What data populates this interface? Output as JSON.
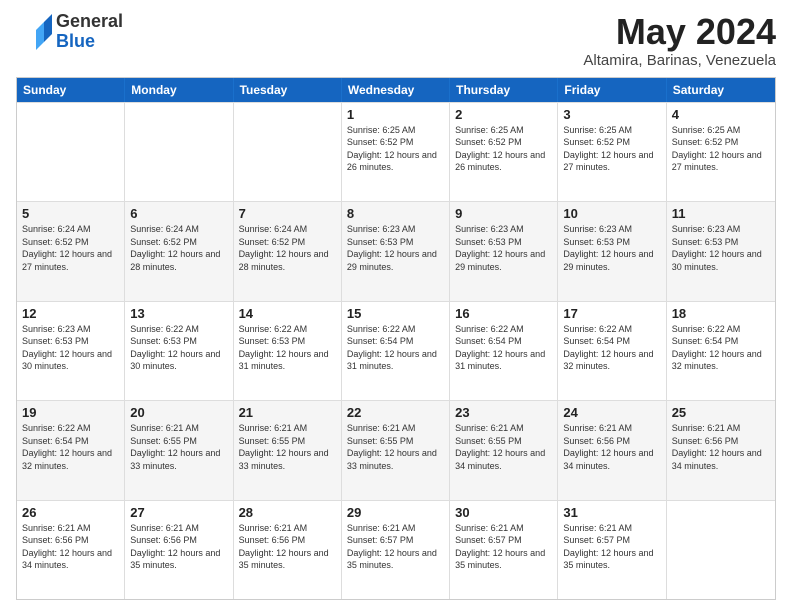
{
  "header": {
    "logo_general": "General",
    "logo_blue": "Blue",
    "month_title": "May 2024",
    "subtitle": "Altamira, Barinas, Venezuela"
  },
  "days_of_week": [
    "Sunday",
    "Monday",
    "Tuesday",
    "Wednesday",
    "Thursday",
    "Friday",
    "Saturday"
  ],
  "weeks": [
    [
      {
        "day": "",
        "info": ""
      },
      {
        "day": "",
        "info": ""
      },
      {
        "day": "",
        "info": ""
      },
      {
        "day": "1",
        "info": "Sunrise: 6:25 AM\nSunset: 6:52 PM\nDaylight: 12 hours\nand 26 minutes."
      },
      {
        "day": "2",
        "info": "Sunrise: 6:25 AM\nSunset: 6:52 PM\nDaylight: 12 hours\nand 26 minutes."
      },
      {
        "day": "3",
        "info": "Sunrise: 6:25 AM\nSunset: 6:52 PM\nDaylight: 12 hours\nand 27 minutes."
      },
      {
        "day": "4",
        "info": "Sunrise: 6:25 AM\nSunset: 6:52 PM\nDaylight: 12 hours\nand 27 minutes."
      }
    ],
    [
      {
        "day": "5",
        "info": "Sunrise: 6:24 AM\nSunset: 6:52 PM\nDaylight: 12 hours\nand 27 minutes."
      },
      {
        "day": "6",
        "info": "Sunrise: 6:24 AM\nSunset: 6:52 PM\nDaylight: 12 hours\nand 28 minutes."
      },
      {
        "day": "7",
        "info": "Sunrise: 6:24 AM\nSunset: 6:52 PM\nDaylight: 12 hours\nand 28 minutes."
      },
      {
        "day": "8",
        "info": "Sunrise: 6:23 AM\nSunset: 6:53 PM\nDaylight: 12 hours\nand 29 minutes."
      },
      {
        "day": "9",
        "info": "Sunrise: 6:23 AM\nSunset: 6:53 PM\nDaylight: 12 hours\nand 29 minutes."
      },
      {
        "day": "10",
        "info": "Sunrise: 6:23 AM\nSunset: 6:53 PM\nDaylight: 12 hours\nand 29 minutes."
      },
      {
        "day": "11",
        "info": "Sunrise: 6:23 AM\nSunset: 6:53 PM\nDaylight: 12 hours\nand 30 minutes."
      }
    ],
    [
      {
        "day": "12",
        "info": "Sunrise: 6:23 AM\nSunset: 6:53 PM\nDaylight: 12 hours\nand 30 minutes."
      },
      {
        "day": "13",
        "info": "Sunrise: 6:22 AM\nSunset: 6:53 PM\nDaylight: 12 hours\nand 30 minutes."
      },
      {
        "day": "14",
        "info": "Sunrise: 6:22 AM\nSunset: 6:53 PM\nDaylight: 12 hours\nand 31 minutes."
      },
      {
        "day": "15",
        "info": "Sunrise: 6:22 AM\nSunset: 6:54 PM\nDaylight: 12 hours\nand 31 minutes."
      },
      {
        "day": "16",
        "info": "Sunrise: 6:22 AM\nSunset: 6:54 PM\nDaylight: 12 hours\nand 31 minutes."
      },
      {
        "day": "17",
        "info": "Sunrise: 6:22 AM\nSunset: 6:54 PM\nDaylight: 12 hours\nand 32 minutes."
      },
      {
        "day": "18",
        "info": "Sunrise: 6:22 AM\nSunset: 6:54 PM\nDaylight: 12 hours\nand 32 minutes."
      }
    ],
    [
      {
        "day": "19",
        "info": "Sunrise: 6:22 AM\nSunset: 6:54 PM\nDaylight: 12 hours\nand 32 minutes."
      },
      {
        "day": "20",
        "info": "Sunrise: 6:21 AM\nSunset: 6:55 PM\nDaylight: 12 hours\nand 33 minutes."
      },
      {
        "day": "21",
        "info": "Sunrise: 6:21 AM\nSunset: 6:55 PM\nDaylight: 12 hours\nand 33 minutes."
      },
      {
        "day": "22",
        "info": "Sunrise: 6:21 AM\nSunset: 6:55 PM\nDaylight: 12 hours\nand 33 minutes."
      },
      {
        "day": "23",
        "info": "Sunrise: 6:21 AM\nSunset: 6:55 PM\nDaylight: 12 hours\nand 34 minutes."
      },
      {
        "day": "24",
        "info": "Sunrise: 6:21 AM\nSunset: 6:56 PM\nDaylight: 12 hours\nand 34 minutes."
      },
      {
        "day": "25",
        "info": "Sunrise: 6:21 AM\nSunset: 6:56 PM\nDaylight: 12 hours\nand 34 minutes."
      }
    ],
    [
      {
        "day": "26",
        "info": "Sunrise: 6:21 AM\nSunset: 6:56 PM\nDaylight: 12 hours\nand 34 minutes."
      },
      {
        "day": "27",
        "info": "Sunrise: 6:21 AM\nSunset: 6:56 PM\nDaylight: 12 hours\nand 35 minutes."
      },
      {
        "day": "28",
        "info": "Sunrise: 6:21 AM\nSunset: 6:56 PM\nDaylight: 12 hours\nand 35 minutes."
      },
      {
        "day": "29",
        "info": "Sunrise: 6:21 AM\nSunset: 6:57 PM\nDaylight: 12 hours\nand 35 minutes."
      },
      {
        "day": "30",
        "info": "Sunrise: 6:21 AM\nSunset: 6:57 PM\nDaylight: 12 hours\nand 35 minutes."
      },
      {
        "day": "31",
        "info": "Sunrise: 6:21 AM\nSunset: 6:57 PM\nDaylight: 12 hours\nand 35 minutes."
      },
      {
        "day": "",
        "info": ""
      }
    ]
  ]
}
